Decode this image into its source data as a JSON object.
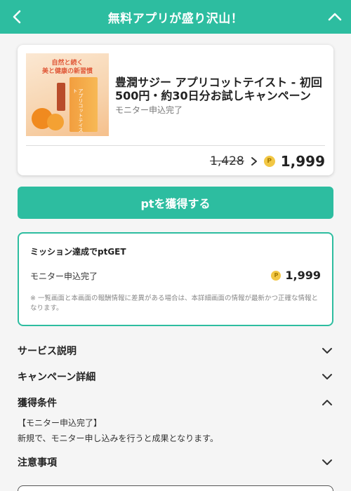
{
  "header": {
    "title": "無料アプリが盛り沢山！",
    "back_icon": "chevron-left-icon",
    "collapse_icon": "chevron-up-icon"
  },
  "product": {
    "image_text_line1": "自然と続く",
    "image_text_line2": "美と健康の新習慣",
    "image_box_text": "アプリコットテイスト",
    "title": "豊潤サジー アプリコットテイスト - 初回500円・約30日分お試しキャンペーン",
    "status": "モニター申込完了",
    "old_price": "1,428",
    "new_price": "1,999",
    "coin_symbol": "P"
  },
  "get_button": {
    "label": "ptを獲得する"
  },
  "mission": {
    "title": "ミッション達成でptGET",
    "item_label": "モニター申込完了",
    "item_points": "1,999",
    "coin_symbol": "P",
    "note": "※ 一覧画面と本画面の報酬情報に差異がある場合は、本詳細画面の情報が最新かつ正確な情報となります。"
  },
  "sections": {
    "service": "サービス説明",
    "campaign": "キャンペーン詳細",
    "conditions": "獲得条件",
    "notes": "注意事項"
  },
  "conditions": {
    "subtitle": "【モニター申込完了】",
    "body": "新規で、モニター申し込みを行うと成果となります。"
  },
  "colors": {
    "accent": "#2dbda0",
    "coin": "#f2c744"
  }
}
